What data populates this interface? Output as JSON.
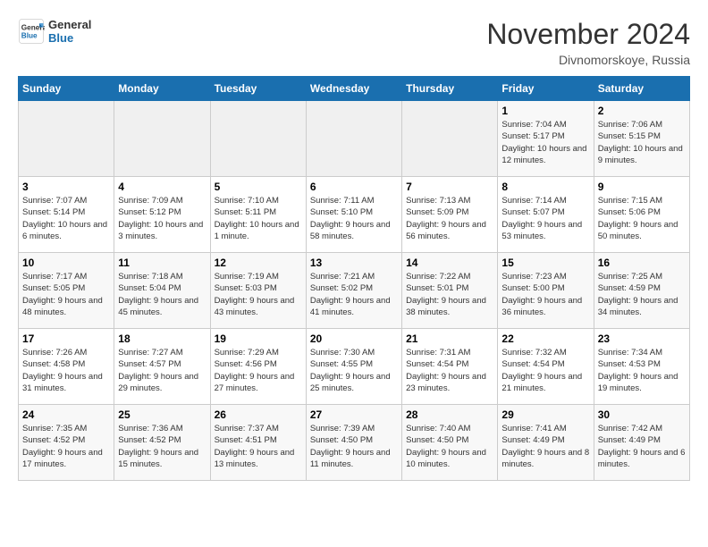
{
  "header": {
    "logo_line1": "General",
    "logo_line2": "Blue",
    "month_title": "November 2024",
    "location": "Divnomorskoye, Russia"
  },
  "days_of_week": [
    "Sunday",
    "Monday",
    "Tuesday",
    "Wednesday",
    "Thursday",
    "Friday",
    "Saturday"
  ],
  "weeks": [
    [
      {
        "day": "",
        "detail": ""
      },
      {
        "day": "",
        "detail": ""
      },
      {
        "day": "",
        "detail": ""
      },
      {
        "day": "",
        "detail": ""
      },
      {
        "day": "",
        "detail": ""
      },
      {
        "day": "1",
        "detail": "Sunrise: 7:04 AM\nSunset: 5:17 PM\nDaylight: 10 hours and 12 minutes."
      },
      {
        "day": "2",
        "detail": "Sunrise: 7:06 AM\nSunset: 5:15 PM\nDaylight: 10 hours and 9 minutes."
      }
    ],
    [
      {
        "day": "3",
        "detail": "Sunrise: 7:07 AM\nSunset: 5:14 PM\nDaylight: 10 hours and 6 minutes."
      },
      {
        "day": "4",
        "detail": "Sunrise: 7:09 AM\nSunset: 5:12 PM\nDaylight: 10 hours and 3 minutes."
      },
      {
        "day": "5",
        "detail": "Sunrise: 7:10 AM\nSunset: 5:11 PM\nDaylight: 10 hours and 1 minute."
      },
      {
        "day": "6",
        "detail": "Sunrise: 7:11 AM\nSunset: 5:10 PM\nDaylight: 9 hours and 58 minutes."
      },
      {
        "day": "7",
        "detail": "Sunrise: 7:13 AM\nSunset: 5:09 PM\nDaylight: 9 hours and 56 minutes."
      },
      {
        "day": "8",
        "detail": "Sunrise: 7:14 AM\nSunset: 5:07 PM\nDaylight: 9 hours and 53 minutes."
      },
      {
        "day": "9",
        "detail": "Sunrise: 7:15 AM\nSunset: 5:06 PM\nDaylight: 9 hours and 50 minutes."
      }
    ],
    [
      {
        "day": "10",
        "detail": "Sunrise: 7:17 AM\nSunset: 5:05 PM\nDaylight: 9 hours and 48 minutes."
      },
      {
        "day": "11",
        "detail": "Sunrise: 7:18 AM\nSunset: 5:04 PM\nDaylight: 9 hours and 45 minutes."
      },
      {
        "day": "12",
        "detail": "Sunrise: 7:19 AM\nSunset: 5:03 PM\nDaylight: 9 hours and 43 minutes."
      },
      {
        "day": "13",
        "detail": "Sunrise: 7:21 AM\nSunset: 5:02 PM\nDaylight: 9 hours and 41 minutes."
      },
      {
        "day": "14",
        "detail": "Sunrise: 7:22 AM\nSunset: 5:01 PM\nDaylight: 9 hours and 38 minutes."
      },
      {
        "day": "15",
        "detail": "Sunrise: 7:23 AM\nSunset: 5:00 PM\nDaylight: 9 hours and 36 minutes."
      },
      {
        "day": "16",
        "detail": "Sunrise: 7:25 AM\nSunset: 4:59 PM\nDaylight: 9 hours and 34 minutes."
      }
    ],
    [
      {
        "day": "17",
        "detail": "Sunrise: 7:26 AM\nSunset: 4:58 PM\nDaylight: 9 hours and 31 minutes."
      },
      {
        "day": "18",
        "detail": "Sunrise: 7:27 AM\nSunset: 4:57 PM\nDaylight: 9 hours and 29 minutes."
      },
      {
        "day": "19",
        "detail": "Sunrise: 7:29 AM\nSunset: 4:56 PM\nDaylight: 9 hours and 27 minutes."
      },
      {
        "day": "20",
        "detail": "Sunrise: 7:30 AM\nSunset: 4:55 PM\nDaylight: 9 hours and 25 minutes."
      },
      {
        "day": "21",
        "detail": "Sunrise: 7:31 AM\nSunset: 4:54 PM\nDaylight: 9 hours and 23 minutes."
      },
      {
        "day": "22",
        "detail": "Sunrise: 7:32 AM\nSunset: 4:54 PM\nDaylight: 9 hours and 21 minutes."
      },
      {
        "day": "23",
        "detail": "Sunrise: 7:34 AM\nSunset: 4:53 PM\nDaylight: 9 hours and 19 minutes."
      }
    ],
    [
      {
        "day": "24",
        "detail": "Sunrise: 7:35 AM\nSunset: 4:52 PM\nDaylight: 9 hours and 17 minutes."
      },
      {
        "day": "25",
        "detail": "Sunrise: 7:36 AM\nSunset: 4:52 PM\nDaylight: 9 hours and 15 minutes."
      },
      {
        "day": "26",
        "detail": "Sunrise: 7:37 AM\nSunset: 4:51 PM\nDaylight: 9 hours and 13 minutes."
      },
      {
        "day": "27",
        "detail": "Sunrise: 7:39 AM\nSunset: 4:50 PM\nDaylight: 9 hours and 11 minutes."
      },
      {
        "day": "28",
        "detail": "Sunrise: 7:40 AM\nSunset: 4:50 PM\nDaylight: 9 hours and 10 minutes."
      },
      {
        "day": "29",
        "detail": "Sunrise: 7:41 AM\nSunset: 4:49 PM\nDaylight: 9 hours and 8 minutes."
      },
      {
        "day": "30",
        "detail": "Sunrise: 7:42 AM\nSunset: 4:49 PM\nDaylight: 9 hours and 6 minutes."
      }
    ]
  ]
}
